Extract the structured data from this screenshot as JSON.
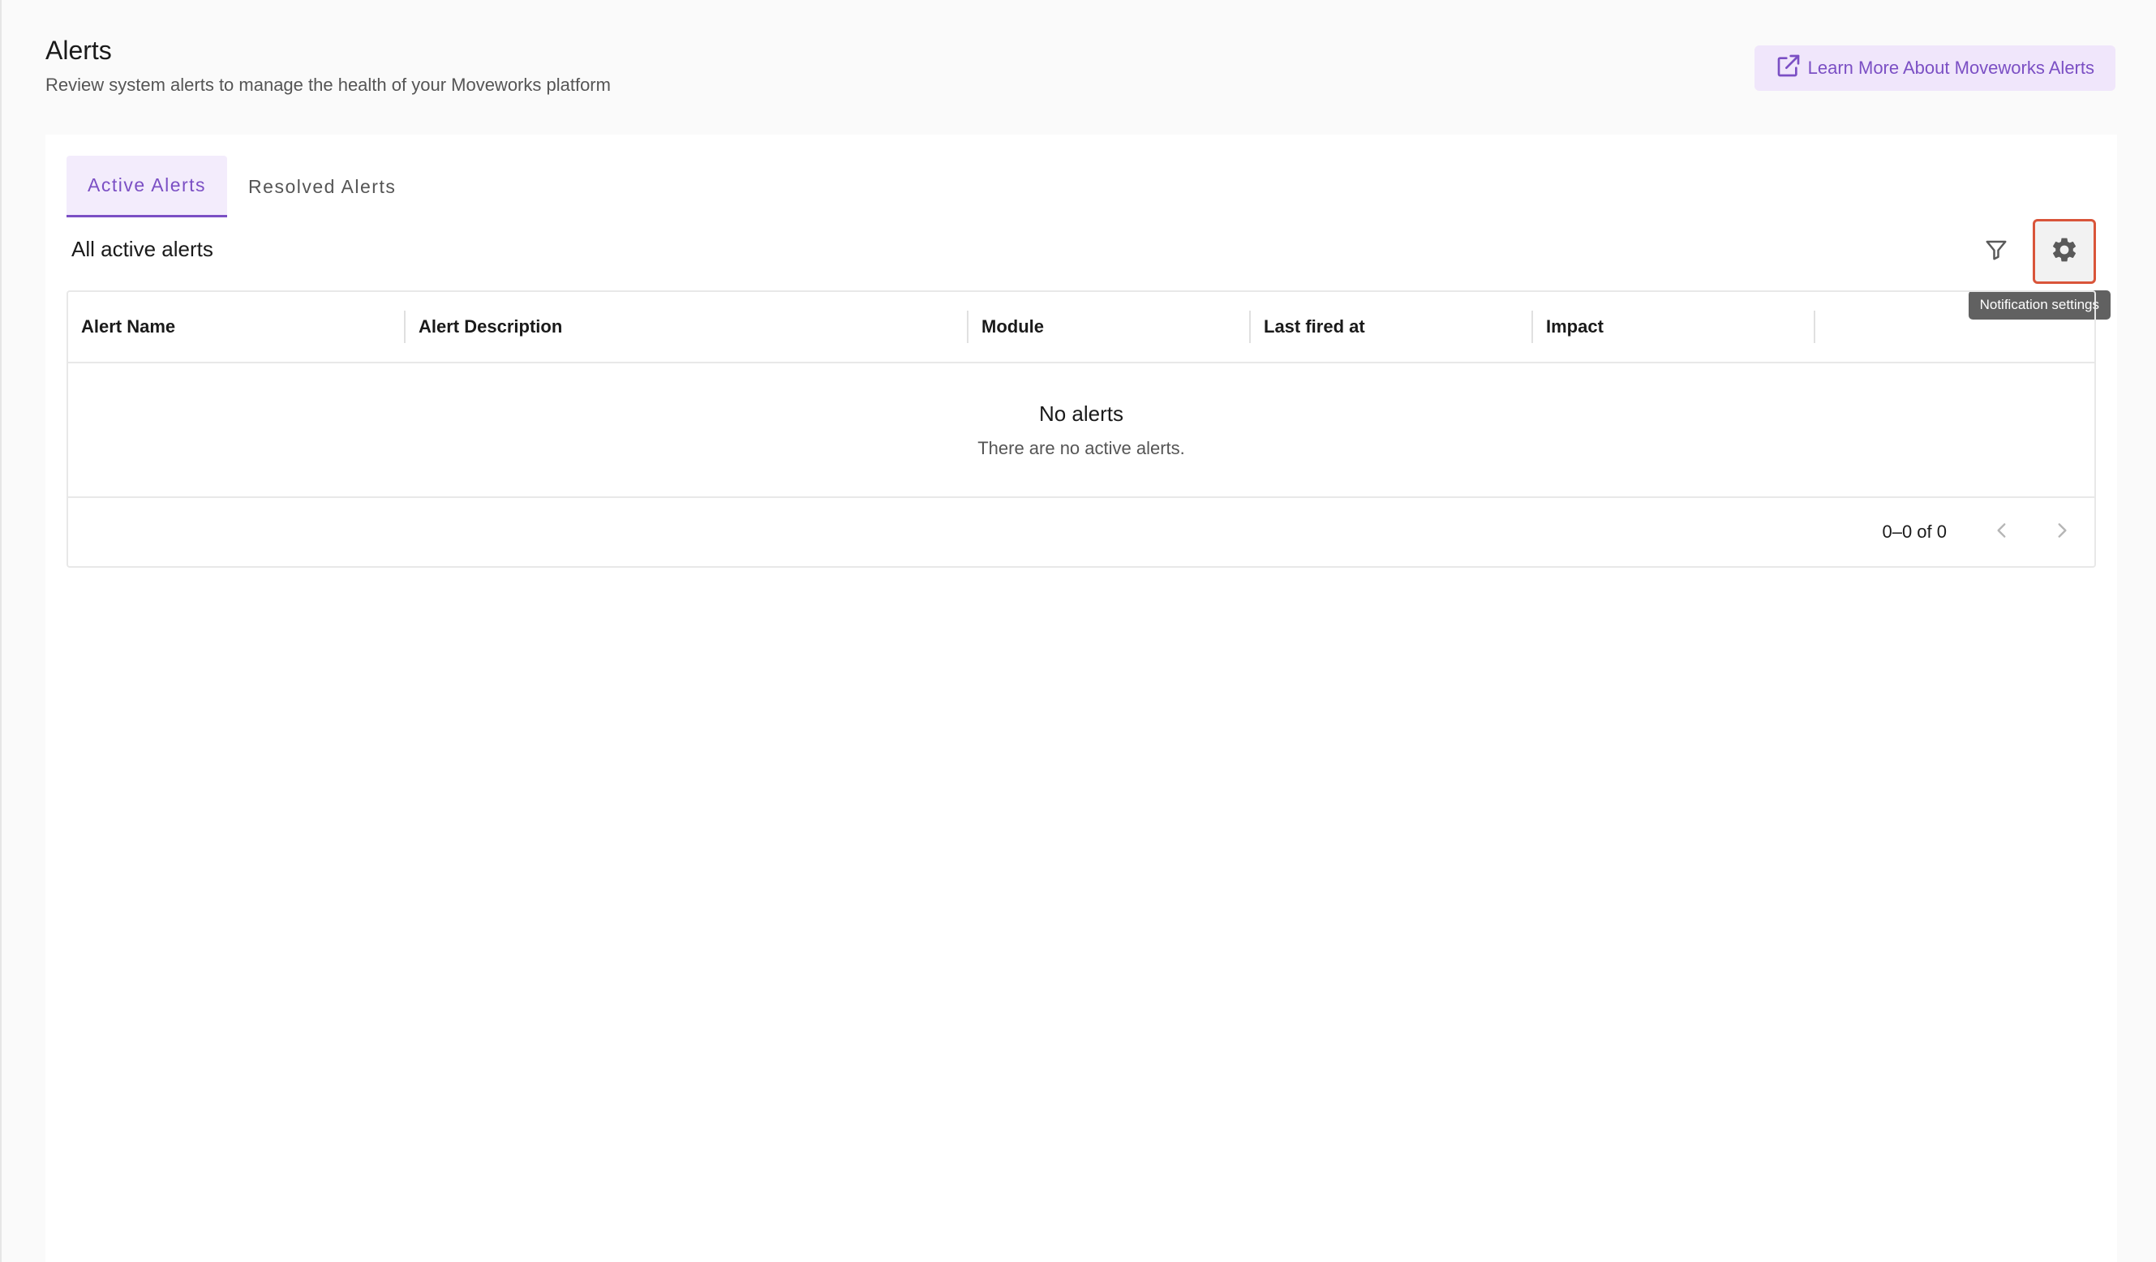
{
  "header": {
    "title": "Alerts",
    "subtitle": "Review system alerts to manage the health of your Moveworks platform",
    "learn_more_label": "Learn More About Moveworks Alerts"
  },
  "tabs": [
    {
      "label": "Active Alerts",
      "active": true
    },
    {
      "label": "Resolved Alerts",
      "active": false
    }
  ],
  "section": {
    "title": "All active alerts"
  },
  "toolbar": {
    "filter_icon": "filter-icon",
    "settings_icon": "gear-icon",
    "settings_tooltip": "Notification settings"
  },
  "table": {
    "columns": [
      "Alert Name",
      "Alert Description",
      "Module",
      "Last fired at",
      "Impact"
    ],
    "empty_title": "No alerts",
    "empty_subtitle": "There are no active alerts."
  },
  "pagination": {
    "info": "0–0 of 0"
  },
  "colors": {
    "accent": "#7b4fc4",
    "accent_bg": "#f0e6fb",
    "highlight_border": "#d9553a"
  }
}
